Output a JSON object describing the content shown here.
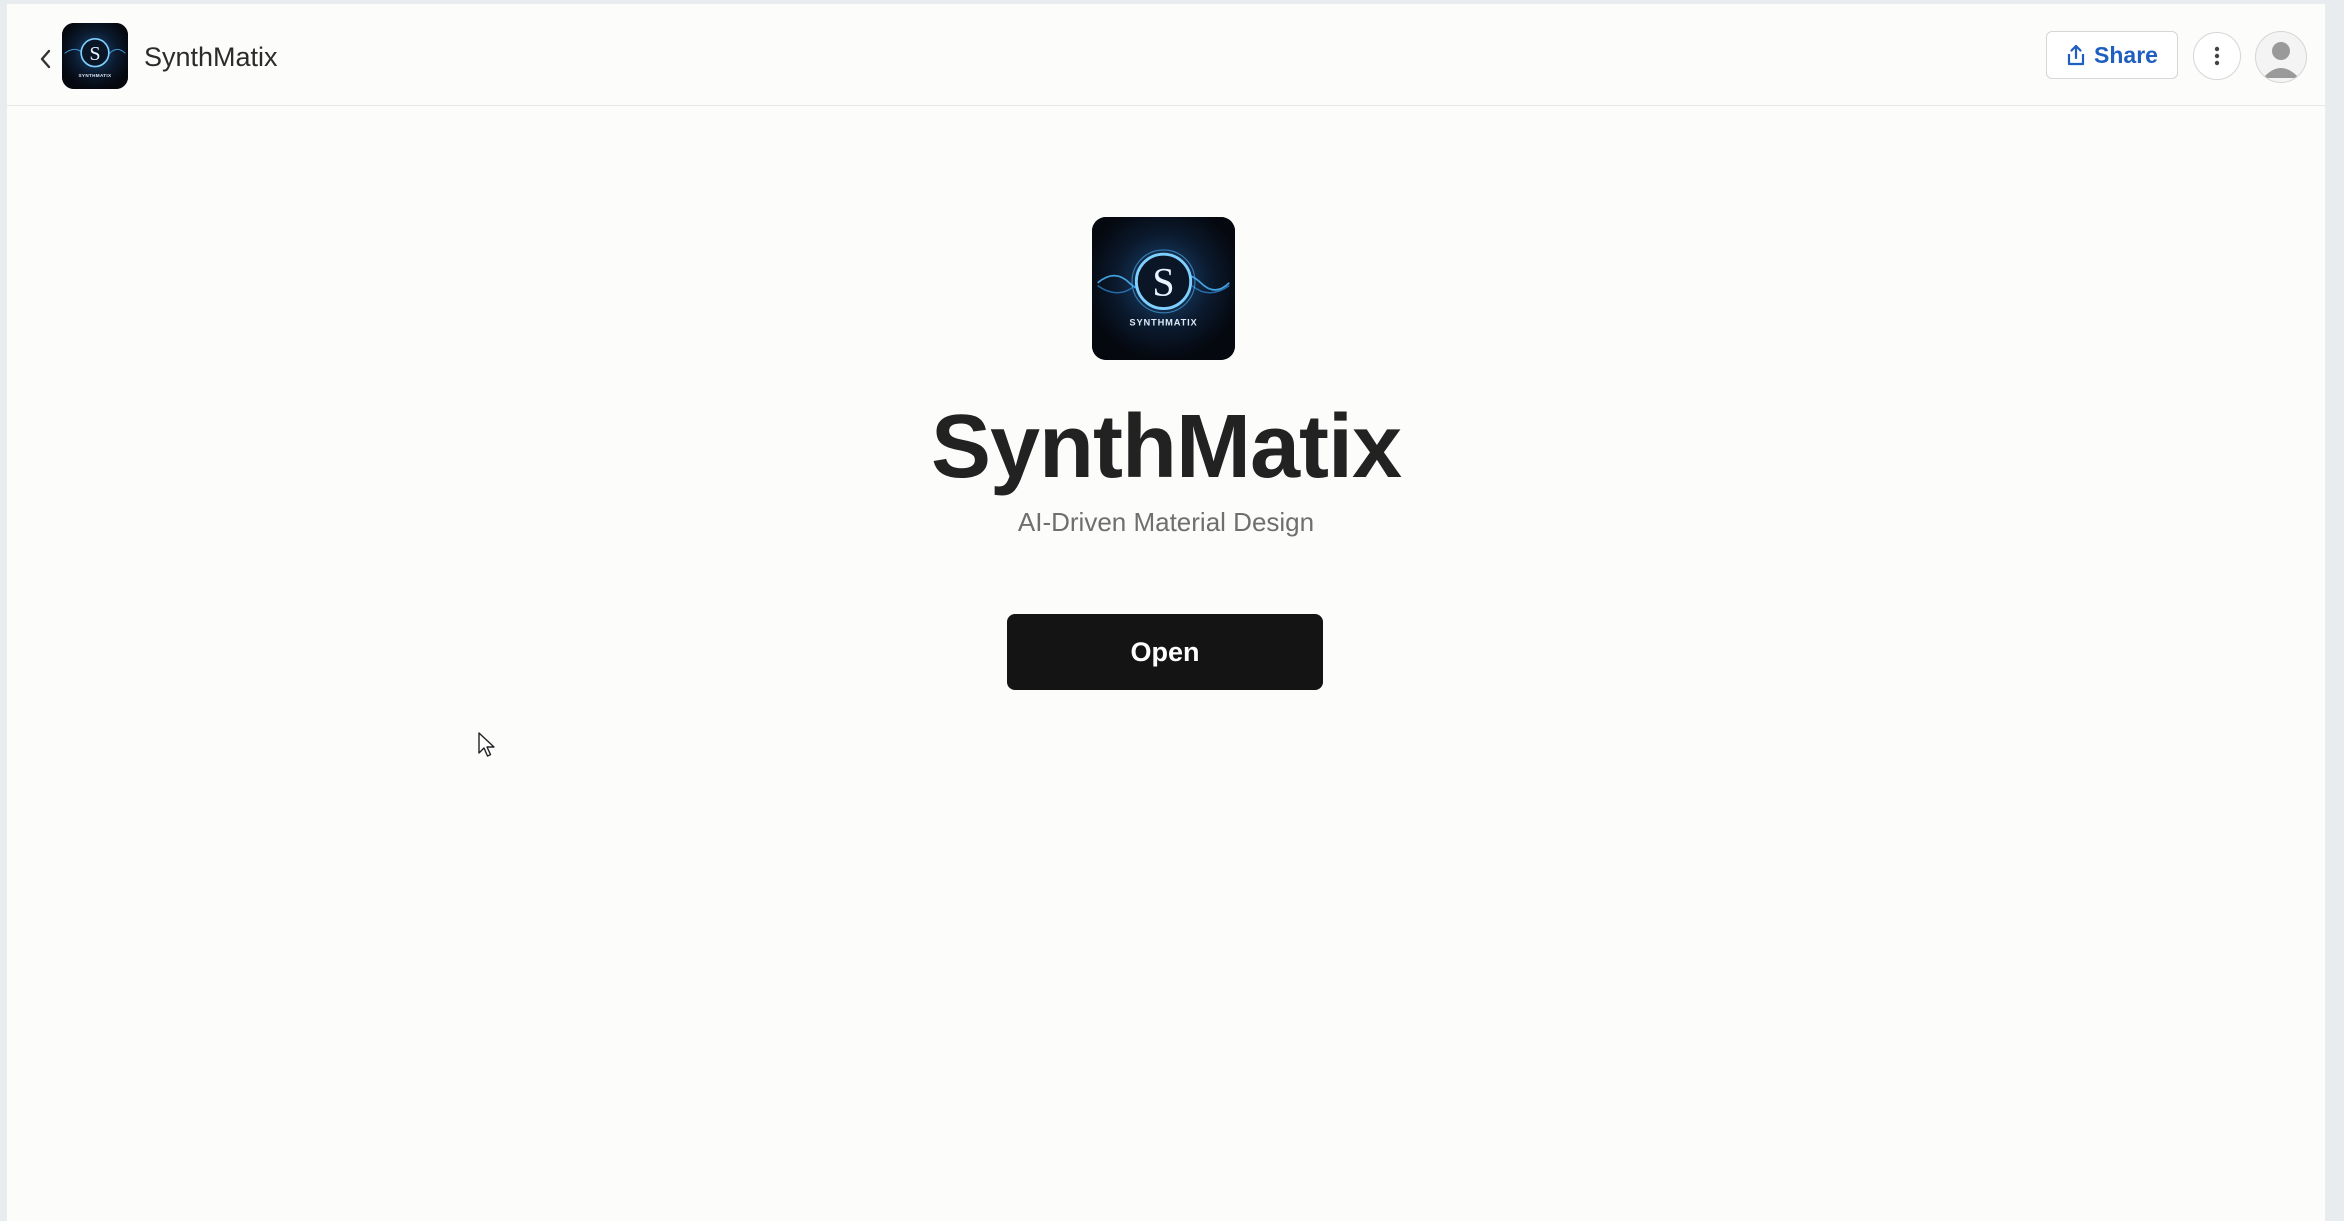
{
  "header": {
    "app_name": "SynthMatix",
    "share_label": "Share"
  },
  "hero": {
    "title": "SynthMatix",
    "subtitle": "AI-Driven Material Design",
    "open_label": "Open",
    "logo_wordmark": "SYNTHMATIX"
  },
  "icons": {
    "back": "chevron-left-icon",
    "share": "share-upload-icon",
    "more": "vertical-dots-icon",
    "avatar": "user-avatar-icon"
  },
  "colors": {
    "accent": "#1f5fbf",
    "primary_button": "#141414",
    "logo_glow": "#4fb8ff"
  }
}
